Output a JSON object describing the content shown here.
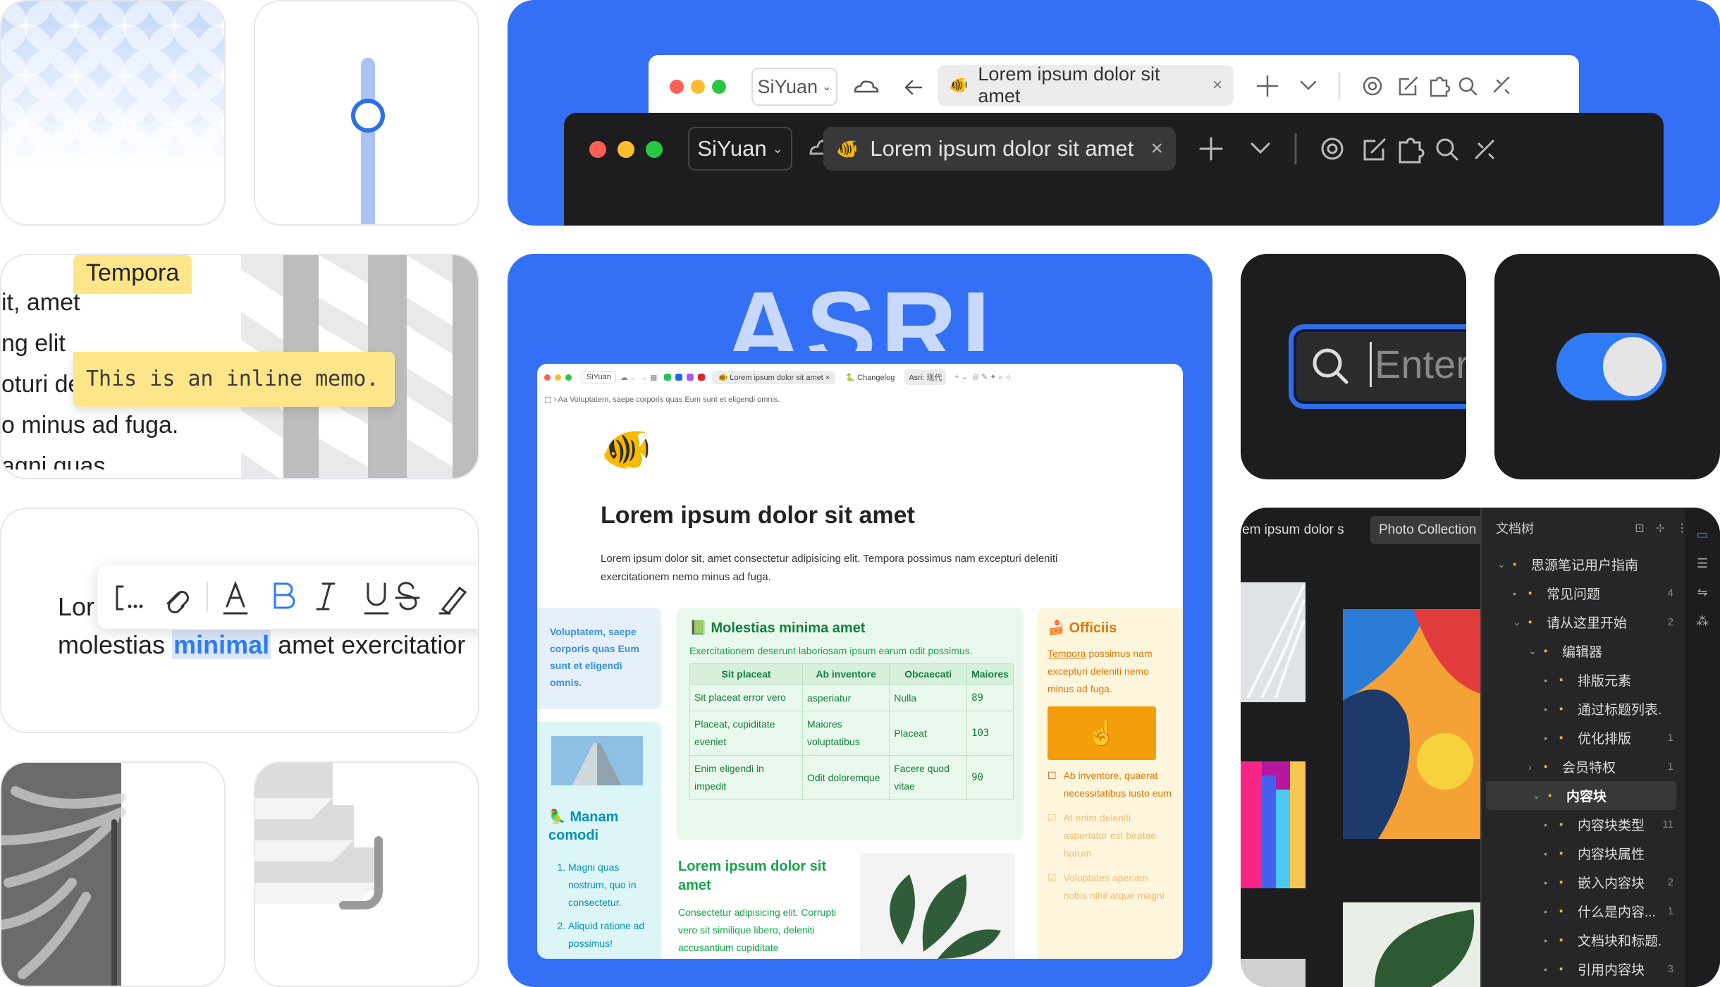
{
  "colors": {
    "brand": "#3470f5",
    "accent": "#2f7bf6",
    "memo_bg": "#fde68a",
    "dark": "#1d1d1f"
  },
  "light_titlebar": {
    "workspace": "SiYuan",
    "tab_title": "Lorem ipsum dolor sit amet"
  },
  "dark_titlebar": {
    "workspace": "SiYuan",
    "tab_title": "Lorem ipsum dolor sit amet"
  },
  "memo_card": {
    "lines": [
      "it, amet",
      "ng elit",
      "oturi de",
      "o minus ad fuga.",
      "agni quas"
    ],
    "highlight": "Tempora",
    "memo": "This is an inline memo."
  },
  "toolbar_card": {
    "line1": "Lor",
    "line2_pre": "molestias ",
    "line2_highlight": "minimal",
    "line2_post": " amet exercitatior"
  },
  "search_card": {
    "placeholder": "Enter"
  },
  "hero": {
    "logo": "ASRI"
  },
  "mini_titlebar": {
    "workspace": "SiYuan",
    "tab1": "Lorem ipsum dolor sit amet",
    "tab2": "Changelog",
    "tab3": "Asri: 现代"
  },
  "doc": {
    "breadcrumb": "Voluptatem, saepe corporis quas Eum sunt et eligendi omnis.",
    "title": "Lorem ipsum dolor sit amet",
    "intro": "Lorem ipsum dolor sit, amet consectetur adipisicing elit. Tempora possimus nam excepturi deleniti exercitationem nemo minus ad fuga."
  },
  "blue_callout": {
    "text": "Voluptatem, saepe corporis quas Eum sunt et eligendi omnis."
  },
  "green_block": {
    "title": "Molestias minima amet",
    "subtitle": "Exercitationem deserunt laboriosam ipsum earum odit possimus.",
    "headers": [
      "Sit placeat",
      "Ab inventore",
      "Obcaecati",
      "Maiores"
    ],
    "rows": [
      [
        "Sit placeat error vero",
        "asperiatur",
        "Nulla",
        "89"
      ],
      [
        "Placeat, cupiditate eveniet",
        "Maiores voluptatibus",
        "Placeat",
        "103"
      ],
      [
        "Enim eligendi in impedit",
        "Odit doloremque",
        "Facere quod vitae",
        "90"
      ]
    ]
  },
  "yellow_block": {
    "title": "Officiis",
    "link": "Tempora",
    "text": " possimus nam excepturi deleniti nemo minus ad fuga.",
    "todos": [
      "Ab inventore, quaerat necessitatibus iusto eum",
      "At enim deleniti asperiatur est beatae harum",
      "Voluptates aperiam nobis nihil atque magni"
    ]
  },
  "teal_block": {
    "title": "Manam comodi",
    "items": [
      "Magni quas nostrum, quo in consectetur.",
      "Aliquid ratione ad possimus!"
    ]
  },
  "lower_green": {
    "title": "Lorem ipsum dolor sit amet",
    "text": "Consectetur adipisicing elit. Corrupti vero sit similique libero, deleniti accusantium cupiditate"
  },
  "files_card": {
    "tab1": "em ipsum dolor s",
    "tab2": "Photo Collection",
    "panel_title": "文档树",
    "tree": [
      {
        "label": "思源笔记用户指南",
        "count": "",
        "level": 0,
        "arrow": "down"
      },
      {
        "label": "常见问题",
        "count": "4",
        "level": 1,
        "arrow": ""
      },
      {
        "label": "请从这里开始",
        "count": "2",
        "level": 1,
        "arrow": "down"
      },
      {
        "label": "编辑器",
        "count": "",
        "level": 2,
        "arrow": "down"
      },
      {
        "label": "排版元素",
        "count": "",
        "level": 3,
        "arrow": ""
      },
      {
        "label": "通过标题列表...",
        "count": "",
        "level": 3,
        "arrow": ""
      },
      {
        "label": "优化排版",
        "count": "1",
        "level": 3,
        "arrow": ""
      },
      {
        "label": "会员特权",
        "count": "1",
        "level": 2,
        "arrow": "right"
      },
      {
        "label": "内容块",
        "count": "",
        "level": 2,
        "arrow": "down",
        "active": true
      },
      {
        "label": "内容块类型",
        "count": "11",
        "level": 3,
        "arrow": ""
      },
      {
        "label": "内容块属性",
        "count": "",
        "level": 3,
        "arrow": ""
      },
      {
        "label": "嵌入内容块",
        "count": "2",
        "level": 3,
        "arrow": ""
      },
      {
        "label": "什么是内容...",
        "count": "1",
        "level": 3,
        "arrow": ""
      },
      {
        "label": "文档块和标题...",
        "count": "",
        "level": 3,
        "arrow": ""
      },
      {
        "label": "引用内容块",
        "count": "3",
        "level": 3,
        "arrow": ""
      }
    ]
  }
}
